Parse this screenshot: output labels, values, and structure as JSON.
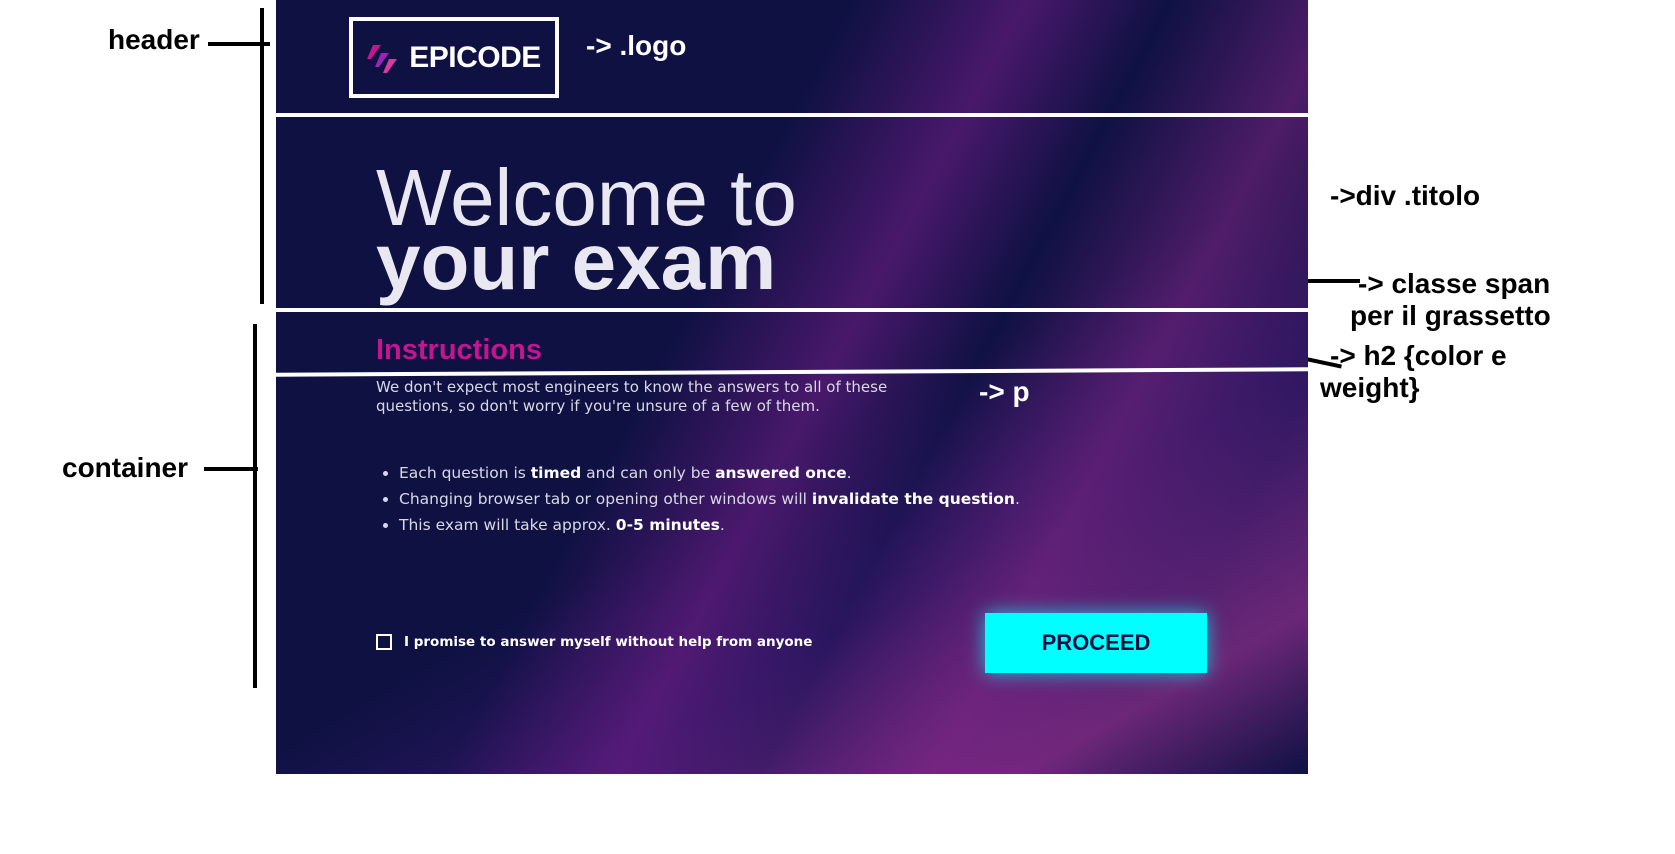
{
  "annotations": {
    "header": "header",
    "logo": "-> .logo",
    "titolo": "->div .titolo",
    "span_line1": "-> classe span",
    "span_line2": "per il grassetto",
    "h2_line1": "-> h2 {color e",
    "h2_line2": "weight}",
    "p": "-> p",
    "container": "container"
  },
  "header": {
    "logo_text": "EPICODE"
  },
  "title": {
    "line1": "Welcome to",
    "line2": "your exam"
  },
  "instructions": {
    "heading": "Instructions",
    "paragraph": "We don't expect most engineers to know the answers to all of these questions, so don't worry if you're unsure of a few of them.",
    "rules": [
      {
        "pre": "Each question is ",
        "b1": "timed",
        "mid": " and can only be ",
        "b2": "answered once",
        "post": "."
      },
      {
        "pre": "Changing browser tab or opening other windows will ",
        "b1": "invalidate the question",
        "post": "."
      },
      {
        "pre": "This exam will take approx. ",
        "b1": "0-5 minutes",
        "post": "."
      }
    ]
  },
  "footer": {
    "promise_label": "I promise to answer myself without help from anyone",
    "proceed_label": "PROCEED"
  },
  "colors": {
    "background": "#0f1143",
    "heading_accent": "#c2158f",
    "button": "#00ffff"
  }
}
